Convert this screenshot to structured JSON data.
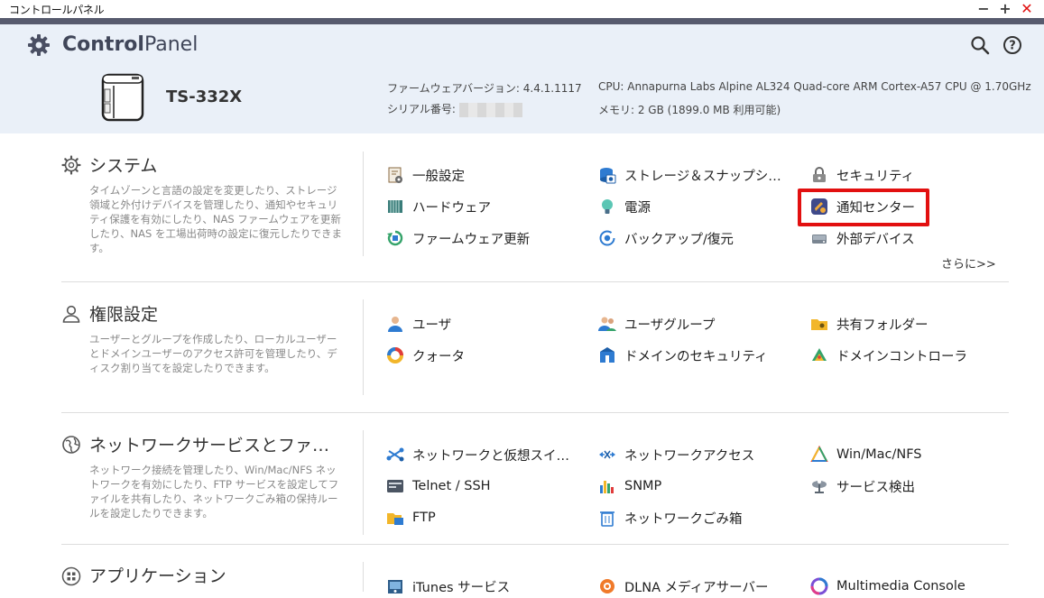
{
  "window": {
    "title": "コントロールパネル",
    "minimize_glyph": "−",
    "maximize_glyph": "+",
    "close_glyph": "✕"
  },
  "header": {
    "brand_bold": "Control",
    "brand_light": "Panel",
    "model": "TS-332X",
    "firmware": "ファームウェアバージョン: 4.4.1.1117",
    "serial_label": "シリアル番号:",
    "cpu": "CPU: Annapurna Labs Alpine AL324 Quad-core ARM Cortex-A57 CPU @ 1.70GHz",
    "memory": "メモリ: 2 GB (1899.0 MB 利用可能)",
    "search_icon": "search-icon",
    "help_icon": "help-icon"
  },
  "sections": {
    "system": {
      "title": "システム",
      "desc": "タイムゾーンと言語の設定を変更したり、ストレージ領域と外付けデバイスを管理したり、通知やセキュリティ保護を有効にしたり、NAS ファームウェアを更新したり、NAS を工場出荷時の設定に復元したりできます。",
      "items": [
        "一般設定",
        "ストレージ＆スナップシ…",
        "セキュリティ",
        "ハードウェア",
        "電源",
        "通知センター",
        "ファームウェア更新",
        "バックアップ/復元",
        "外部デバイス"
      ],
      "more": "さらに>>"
    },
    "privilege": {
      "title": "権限設定",
      "desc": "ユーザーとグループを作成したり、ローカルユーザーとドメインユーザーのアクセス許可を管理したり、ディスク割り当てを設定したりできます。",
      "items": [
        "ユーザ",
        "ユーザグループ",
        "共有フォルダー",
        "クォータ",
        "ドメインのセキュリティ",
        "ドメインコントローラ"
      ]
    },
    "network": {
      "title": "ネットワークサービスとファ…",
      "desc": "ネットワーク接続を管理したり、Win/Mac/NFS ネットワークを有効にしたり、FTP サービスを設定してファイルを共有したり、ネットワークごみ箱の保持ルールを設定したりできます。",
      "items": [
        "ネットワークと仮想スイ…",
        "ネットワークアクセス",
        "Win/Mac/NFS",
        "Telnet / SSH",
        "SNMP",
        "サービス検出",
        "FTP",
        "ネットワークごみ箱"
      ]
    },
    "apps": {
      "title": "アプリケーション",
      "items": [
        "iTunes サービス",
        "DLNA メディアサーバー",
        "Multimedia Console"
      ]
    }
  },
  "colors": {
    "highlight": "#e21010",
    "header_bg": "#eaf0f8",
    "band": "#575b6e"
  }
}
